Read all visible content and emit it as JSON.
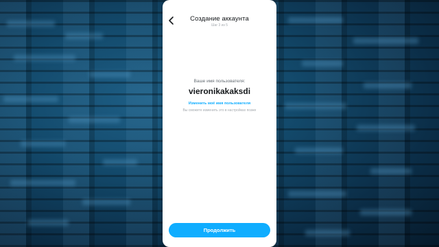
{
  "header": {
    "title": "Создание аккаунта",
    "step": "Шаг 3 из 5"
  },
  "username": {
    "label": "Ваше имя пользователя:",
    "value": "vieronikakaksdi",
    "change_link": "Изменить моё имя пользователя",
    "hint": "Вы сможете изменить это в настройках позже"
  },
  "actions": {
    "continue_label": "Продолжить"
  },
  "icons": {
    "back": "chevron-left-icon"
  },
  "colors": {
    "accent": "#0fadff",
    "background": "#0d3553",
    "panel": "#ffffff",
    "text_primary": "#16191c",
    "text_secondary": "#a4a9ae"
  }
}
